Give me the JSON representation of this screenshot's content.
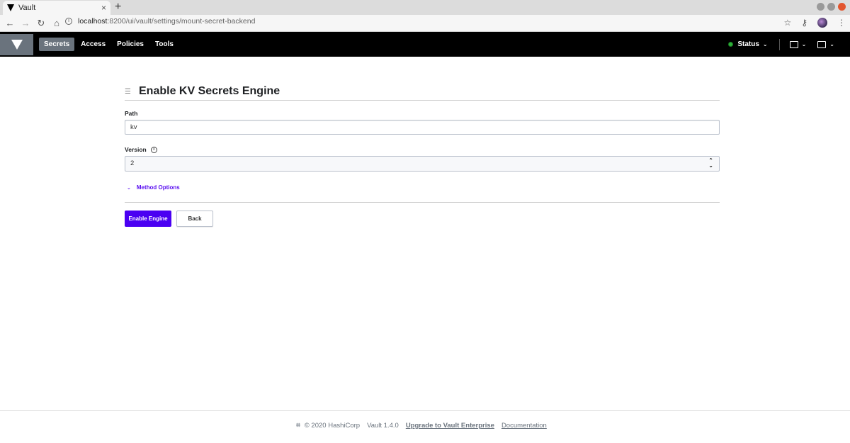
{
  "browser": {
    "tab_title": "Vault",
    "tab_close": "×",
    "new_tab": "+",
    "url_host": "localhost",
    "url_path": ":8200/ui/vault/settings/mount-secret-backend"
  },
  "nav": {
    "links": [
      "Secrets",
      "Access",
      "Policies",
      "Tools"
    ],
    "status_label": "Status",
    "status_color": "#2eb039"
  },
  "page": {
    "title": "Enable KV Secrets Engine",
    "path_label": "Path",
    "path_value": "kv",
    "version_label": "Version",
    "version_value": "2",
    "method_options": "Method Options",
    "enable_button": "Enable Engine",
    "back_button": "Back",
    "accent_color": "#4a00f2"
  },
  "footer": {
    "copyright": "© 2020 HashiCorp",
    "version": "Vault 1.4.0",
    "upgrade_link": "Upgrade to Vault Enterprise",
    "docs_link": "Documentation"
  }
}
